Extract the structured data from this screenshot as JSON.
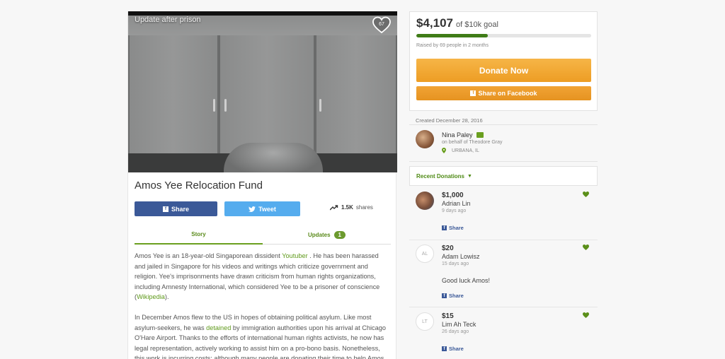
{
  "video": {
    "title": "Update after prison",
    "likes": "67"
  },
  "campaign": {
    "title": "Amos Yee Relocation Fund"
  },
  "share": {
    "facebook_label": "Share",
    "twitter_label": "Tweet",
    "count": "1.5K",
    "count_label": "shares"
  },
  "tabs": {
    "story": "Story",
    "updates": "Updates",
    "updates_count": "1"
  },
  "story": {
    "p1_a": "Amos Yee is an 18-year-old Singaporean dissident ",
    "p1_link": "Youtuber",
    "p1_b": " . He has been harassed and jailed in Singapore for his videos and writings which criticize government and religion. Yee's imprisonments have drawn criticism from human rights organizations, including Amnesty International, which considered Yee to be a prisoner of conscience (",
    "p1_link2": "Wikipedia",
    "p1_c": ").",
    "p2_a": "In December Amos flew to the US in hopes of obtaining political asylum. Like most asylum-seekers, he was ",
    "p2_link": "detained",
    "p2_b": " by immigration authorities upon his arrival at Chicago O'Hare Airport. Thanks to the efforts of international human rights activists, he now has legal representation, actively working to assist him on a pro-bono basis. Nonetheless, this work is incurring costs; although many people are donating their time to help Amos,"
  },
  "donate": {
    "amount": "$4,107",
    "goal": "of $10k goal",
    "progress_fraction": 0.41,
    "raised_sub": "Raised by 69 people in 2 months",
    "donate_label": "Donate Now",
    "fb_label": "Share on Facebook"
  },
  "organizer": {
    "created": "Created December 28, 2016",
    "name": "Nina Paley",
    "behalf": "on behalf of Theodore Gray",
    "location": "URBANA, IL"
  },
  "recent": {
    "header": "Recent Donations",
    "items": [
      {
        "amount": "$1,000",
        "name": "Adrian Lin",
        "time": "9 days ago",
        "initials": "",
        "message": "",
        "share": "Share"
      },
      {
        "amount": "$20",
        "name": "Adam Lowisz",
        "time": "15 days ago",
        "initials": "AL",
        "message": "Good luck Amos!",
        "share": "Share"
      },
      {
        "amount": "$15",
        "name": "Lim Ah Teck",
        "time": "26 days ago",
        "initials": "LT",
        "message": "",
        "share": "Share"
      }
    ]
  },
  "colors": {
    "facebook": "#3b5998",
    "twitter": "#55acee",
    "green": "#6a9f1f",
    "orange": "#f0a22e"
  }
}
